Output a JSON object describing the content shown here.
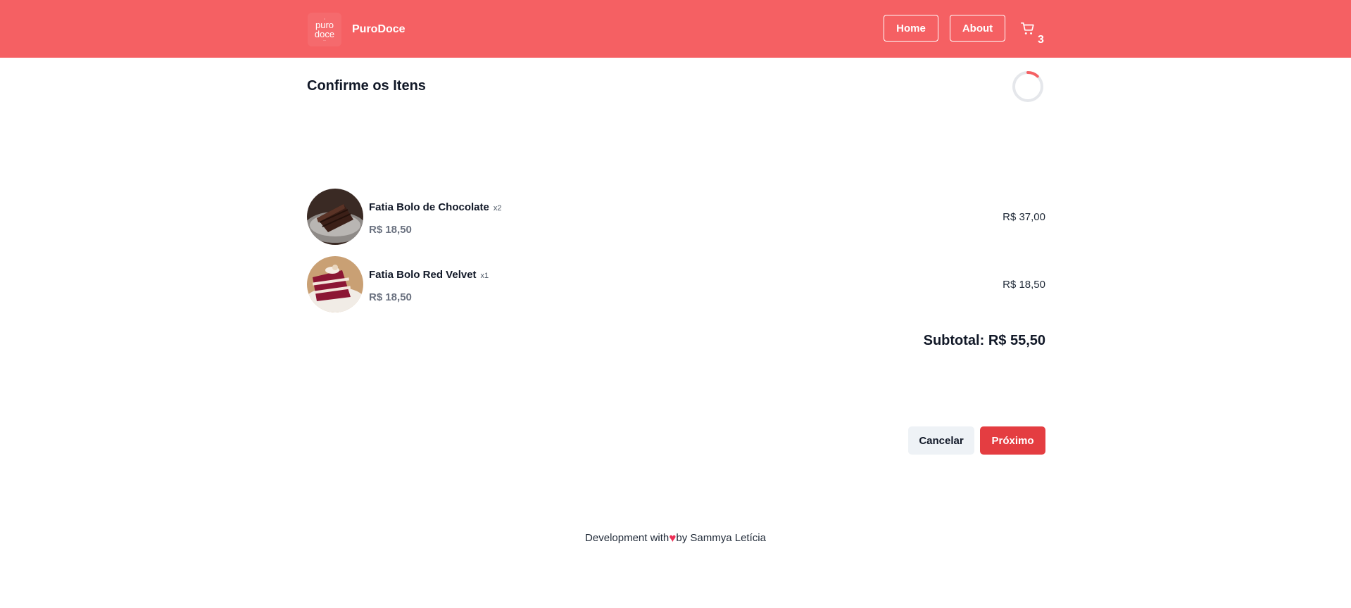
{
  "header": {
    "logo_line1": "puro",
    "logo_line2": "doce",
    "brand_name": "PuroDoce",
    "nav": {
      "home": "Home",
      "about": "About"
    },
    "cart_count": "3"
  },
  "main": {
    "title": "Confirme os Itens",
    "progress_fraction": 0.12,
    "items": [
      {
        "name": "Fatia Bolo de Chocolate",
        "quantity": "x2",
        "unit_price": "R$ 18,50",
        "line_total": "R$ 37,00"
      },
      {
        "name": "Fatia Bolo Red Velvet",
        "quantity": "x1",
        "unit_price": "R$ 18,50",
        "line_total": "R$ 18,50"
      }
    ],
    "subtotal_label": "Subtotal:",
    "subtotal_value": "R$ 55,50",
    "cancel_label": "Cancelar",
    "next_label": "Próximo"
  },
  "footer": {
    "prefix": "Development with",
    "suffix": "by Sammya Letícia"
  },
  "colors": {
    "header": "#f56063",
    "accent": "#e43d41",
    "cancel_bg": "#eef2f6"
  },
  "icons": {
    "cart": "cart-icon",
    "heart": "heart-icon"
  }
}
